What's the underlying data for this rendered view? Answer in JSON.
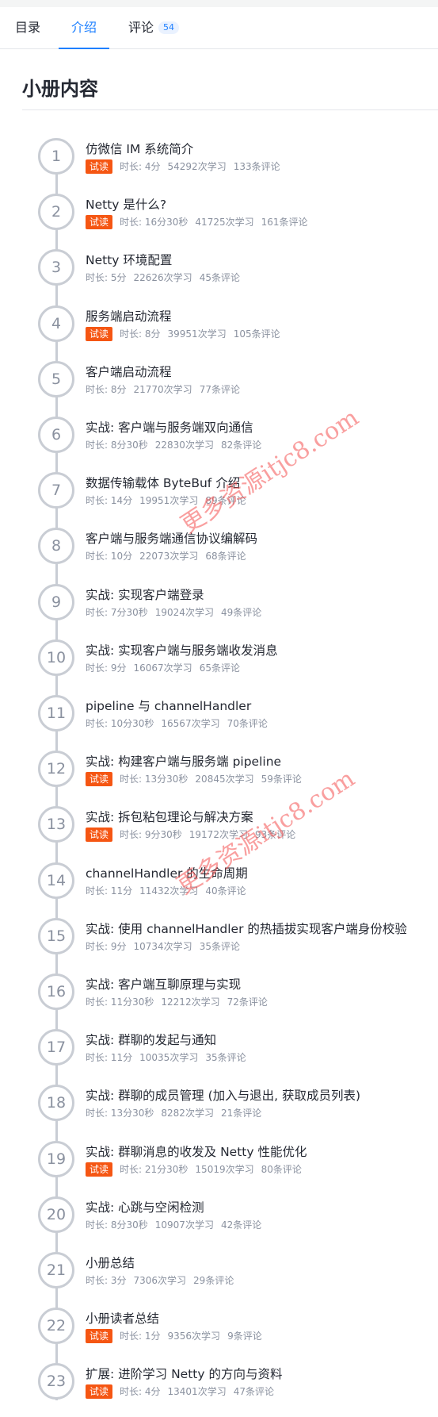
{
  "tabs": [
    {
      "label": "目录"
    },
    {
      "label": "介绍"
    },
    {
      "label": "评论",
      "badge": "54"
    }
  ],
  "section": {
    "title": "小册内容"
  },
  "watermark": "更多资源itjc8.com",
  "labels": {
    "trial": "试读"
  },
  "items": [
    {
      "num": "1",
      "title": "仿微信 IM 系统简介",
      "trial": true,
      "duration": "时长: 4分",
      "learners": "54292次学习",
      "comments": "133条评论"
    },
    {
      "num": "2",
      "title": "Netty 是什么?",
      "trial": true,
      "duration": "时长: 16分30秒",
      "learners": "41725次学习",
      "comments": "161条评论"
    },
    {
      "num": "3",
      "title": "Netty 环境配置",
      "trial": false,
      "duration": "时长: 5分",
      "learners": "22626次学习",
      "comments": "45条评论"
    },
    {
      "num": "4",
      "title": "服务端启动流程",
      "trial": true,
      "duration": "时长: 8分",
      "learners": "39951次学习",
      "comments": "105条评论"
    },
    {
      "num": "5",
      "title": "客户端启动流程",
      "trial": false,
      "duration": "时长: 8分",
      "learners": "21770次学习",
      "comments": "77条评论"
    },
    {
      "num": "6",
      "title": "实战: 客户端与服务端双向通信",
      "trial": false,
      "duration": "时长: 8分30秒",
      "learners": "22830次学习",
      "comments": "82条评论"
    },
    {
      "num": "7",
      "title": "数据传输载体 ByteBuf 介绍",
      "trial": false,
      "duration": "时长: 14分",
      "learners": "19951次学习",
      "comments": "89条评论"
    },
    {
      "num": "8",
      "title": "客户端与服务端通信协议编解码",
      "trial": false,
      "duration": "时长: 10分",
      "learners": "22073次学习",
      "comments": "68条评论"
    },
    {
      "num": "9",
      "title": "实战: 实现客户端登录",
      "trial": false,
      "duration": "时长: 7分30秒",
      "learners": "19024次学习",
      "comments": "49条评论"
    },
    {
      "num": "10",
      "title": "实战: 实现客户端与服务端收发消息",
      "trial": false,
      "duration": "时长: 9分",
      "learners": "16067次学习",
      "comments": "65条评论"
    },
    {
      "num": "11",
      "title": "pipeline 与 channelHandler",
      "trial": false,
      "duration": "时长: 10分30秒",
      "learners": "16567次学习",
      "comments": "70条评论"
    },
    {
      "num": "12",
      "title": "实战: 构建客户端与服务端 pipeline",
      "trial": true,
      "duration": "时长: 13分30秒",
      "learners": "20845次学习",
      "comments": "59条评论"
    },
    {
      "num": "13",
      "title": "实战: 拆包粘包理论与解决方案",
      "trial": true,
      "duration": "时长: 9分30秒",
      "learners": "19172次学习",
      "comments": "93条评论"
    },
    {
      "num": "14",
      "title": "channelHandler 的生命周期",
      "trial": false,
      "duration": "时长: 11分",
      "learners": "11432次学习",
      "comments": "40条评论"
    },
    {
      "num": "15",
      "title": "实战: 使用 channelHandler 的热插拔实现客户端身份校验",
      "trial": false,
      "duration": "时长: 9分",
      "learners": "10734次学习",
      "comments": "35条评论"
    },
    {
      "num": "16",
      "title": "实战: 客户端互聊原理与实现",
      "trial": false,
      "duration": "时长: 11分30秒",
      "learners": "12212次学习",
      "comments": "72条评论"
    },
    {
      "num": "17",
      "title": "实战: 群聊的发起与通知",
      "trial": false,
      "duration": "时长: 11分",
      "learners": "10035次学习",
      "comments": "35条评论"
    },
    {
      "num": "18",
      "title": "实战: 群聊的成员管理 (加入与退出, 获取成员列表)",
      "trial": false,
      "duration": "时长: 13分30秒",
      "learners": "8282次学习",
      "comments": "21条评论"
    },
    {
      "num": "19",
      "title": "实战: 群聊消息的收发及 Netty 性能优化",
      "trial": true,
      "duration": "时长: 21分30秒",
      "learners": "15019次学习",
      "comments": "80条评论"
    },
    {
      "num": "20",
      "title": "实战: 心跳与空闲检测",
      "trial": false,
      "duration": "时长: 8分30秒",
      "learners": "10907次学习",
      "comments": "42条评论"
    },
    {
      "num": "21",
      "title": "小册总结",
      "trial": false,
      "duration": "时长: 3分",
      "learners": "7306次学习",
      "comments": "29条评论"
    },
    {
      "num": "22",
      "title": "小册读者总结",
      "trial": true,
      "duration": "时长: 1分",
      "learners": "9356次学习",
      "comments": "9条评论"
    },
    {
      "num": "23",
      "title": "扩展: 进阶学习 Netty 的方向与资料",
      "trial": true,
      "duration": "时长: 4分",
      "learners": "13401次学习",
      "comments": "47条评论"
    }
  ]
}
